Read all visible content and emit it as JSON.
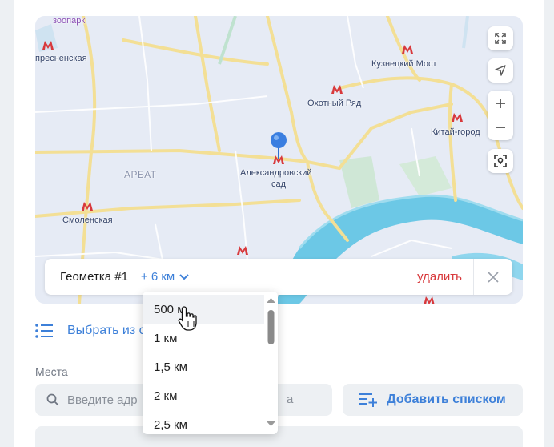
{
  "map": {
    "labels": {
      "zoo": "зоопарк",
      "presnenskaya": "пресненская",
      "kuznetsky": "Кузнецкий Мост",
      "okhotny": "Охотный Ряд",
      "kitay": "Китай-город",
      "arbat": "АРБАТ",
      "aleksandrovsky_1": "Александровский",
      "aleksandrovsky_2": "сад",
      "smolenskaya": "Смоленская"
    },
    "controls": [
      "fullscreen-icon",
      "navigation-arrow-icon",
      "zoom-in-icon",
      "zoom-out-icon",
      "location-target-icon"
    ]
  },
  "geomark": {
    "title": "Геометка #1",
    "radius": "+ 6 км",
    "delete_label": "удалить"
  },
  "radius_dropdown": {
    "options": [
      "500 м",
      "1 км",
      "1,5 км",
      "2 км",
      "2,5 км"
    ],
    "hovered_index": 0
  },
  "pick": {
    "label": "Выбрать из с"
  },
  "places": {
    "section_label": "Места",
    "search_placeholder": "Введите адр",
    "search_tail": "а",
    "add_list_label": "Добавить списком"
  },
  "colors": {
    "accent": "#3d80d9",
    "danger": "#d8393c",
    "metro": "#d8393c",
    "river": "#5fc3e4",
    "roads": "#f2dc8c"
  }
}
